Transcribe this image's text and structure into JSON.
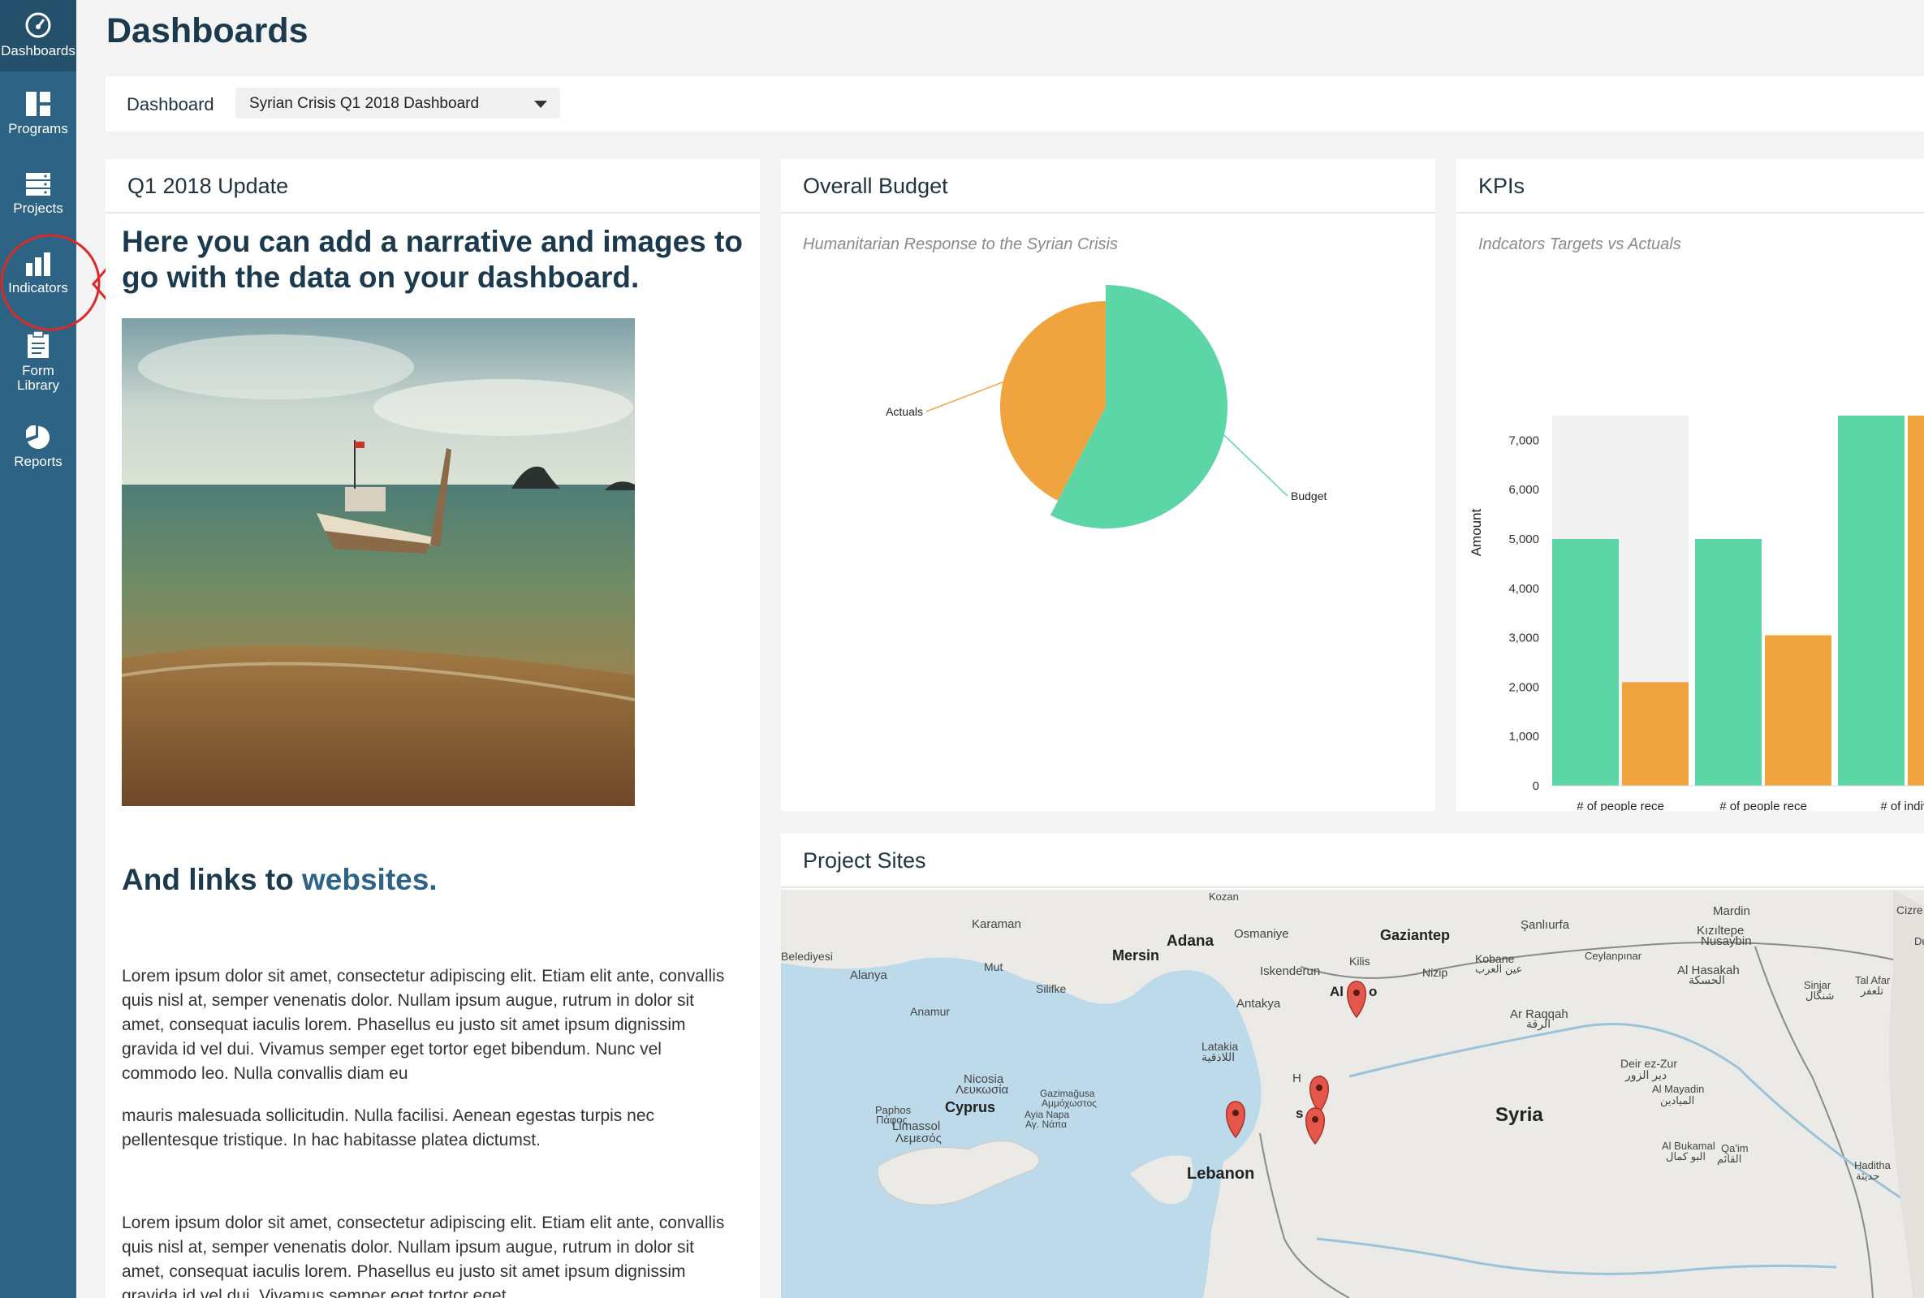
{
  "sidebar": {
    "items": [
      {
        "label": "Dashboards",
        "icon": "speedometer-icon"
      },
      {
        "label": "Programs",
        "icon": "grid-icon"
      },
      {
        "label": "Projects",
        "icon": "server-icon"
      },
      {
        "label": "Indicators",
        "icon": "bar-chart-icon"
      },
      {
        "label_line1": "Form",
        "label_line2": "Library",
        "icon": "clipboard-icon"
      },
      {
        "label": "Reports",
        "icon": "pie-chart-icon"
      }
    ]
  },
  "header": {
    "title": "Dashboards"
  },
  "filter": {
    "label": "Dashboard",
    "selected": "Syrian Crisis Q1 2018 Dashboard"
  },
  "update_card": {
    "title": "Q1 2018 Update",
    "narrative": "Here you can add a narrative and images to go with the data on your dashboard.",
    "links_prefix": "And links to ",
    "links_link": "websites.",
    "paragraph1": "Lorem ipsum dolor sit amet, consectetur adipiscing elit. Etiam elit ante, convallis quis nisl at, semper venenatis dolor. Nullam ipsum augue, rutrum in dolor sit amet, consequat iaculis lorem. Phasellus eu justo sit amet ipsum dignissim gravida id vel dui. Vivamus semper eget tortor eget bibendum. Nunc vel commodo leo. Nulla convallis diam eu",
    "paragraph2": "mauris malesuada sollicitudin. Nulla facilisi. Aenean egestas turpis nec pellentesque tristique. In hac habitasse platea dictumst.",
    "paragraph3": "Lorem ipsum dolor sit amet, consectetur adipiscing elit. Etiam elit ante, convallis quis nisl at, semper venenatis dolor. Nullam ipsum augue, rutrum in dolor sit amet, consequat iaculis lorem. Phasellus eu justo sit amet ipsum dignissim gravida id vel dui. Vivamus semper eget tortor eget"
  },
  "budget_card": {
    "title": "Overall Budget",
    "subtitle": "Humanitarian Response to the Syrian Crisis"
  },
  "kpi_card": {
    "title": "KPIs",
    "subtitle": "Indcators Targets vs Actuals",
    "ylabel": "Amount"
  },
  "map_card": {
    "title": "Project Sites",
    "labels": [
      {
        "text": "Karaman"
      },
      {
        "text": "Adana"
      },
      {
        "text": "Osmaniye"
      },
      {
        "text": "Gaziantep"
      },
      {
        "text": "Şanlıurfa"
      },
      {
        "text": "Mardin"
      },
      {
        "text": "Cizre"
      },
      {
        "text": "Mersin"
      },
      {
        "text": "Belediyesi"
      },
      {
        "text": "Alanya"
      },
      {
        "text": "Mut"
      },
      {
        "text": "Silifke"
      },
      {
        "text": "Kilis"
      },
      {
        "text": "Nizip"
      },
      {
        "text": "Iskenderun"
      },
      {
        "text": "Kobane"
      },
      {
        "text": "عين العرب"
      },
      {
        "text": "Ceylanpınar"
      },
      {
        "text": "Kızıltepe"
      },
      {
        "text": "Nusaybin"
      },
      {
        "text": "Al Hasakah"
      },
      {
        "text": "الحسكة"
      },
      {
        "text": "Antakya"
      },
      {
        "text": "Anamur"
      },
      {
        "text": "Al"
      },
      {
        "text": "o"
      },
      {
        "text": "Ar Raqqah"
      },
      {
        "text": "الرقة"
      },
      {
        "text": "Sinjar"
      },
      {
        "text": "شنگال"
      },
      {
        "text": "Tal Afar"
      },
      {
        "text": "تلعفر"
      },
      {
        "text": "Latakia"
      },
      {
        "text": "اللاذقية"
      },
      {
        "text": "Nicosia"
      },
      {
        "text": "Λευκωσία"
      },
      {
        "text": "Cyprus"
      },
      {
        "text": "Gazimağusa"
      },
      {
        "text": "Αμμόχωστος"
      },
      {
        "text": "Paphos"
      },
      {
        "text": "Πάφος"
      },
      {
        "text": "Limassol"
      },
      {
        "text": "Λεμεσός"
      },
      {
        "text": "Ayia Napa"
      },
      {
        "text": "Αγ. Νάπα"
      },
      {
        "text": "H"
      },
      {
        "text": "a"
      },
      {
        "text": "s"
      },
      {
        "text": "Syria"
      },
      {
        "text": "Deir ez-Zur"
      },
      {
        "text": "دير الزور"
      },
      {
        "text": "Al Mayadin"
      },
      {
        "text": "الميادين"
      },
      {
        "text": "Al Bukamal"
      },
      {
        "text": "البو كمال"
      },
      {
        "text": "Qa'im"
      },
      {
        "text": "القائم"
      },
      {
        "text": "Haditha"
      },
      {
        "text": "حديثة"
      },
      {
        "text": "Lebanon"
      },
      {
        "text": "Du"
      },
      {
        "text": "Kozan"
      }
    ]
  },
  "chart_data": [
    {
      "type": "pie",
      "title": "Overall Budget",
      "subtitle": "Humanitarian Response to the Syrian Crisis",
      "slices": [
        {
          "label": "Budget",
          "value": 57.5,
          "color": "#5cd5a7"
        },
        {
          "label": "Actuals",
          "value": 42.5,
          "color": "#f0a43f"
        }
      ]
    },
    {
      "type": "bar",
      "title": "KPIs",
      "subtitle": "Indcators Targets vs Actuals",
      "ylabel": "Amount",
      "ylim": [
        0,
        7500
      ],
      "yticks": [
        "0",
        "1,000",
        "2,000",
        "3,000",
        "4,000",
        "5,000",
        "6,000",
        "7,000"
      ],
      "categories": [
        "# of people rece",
        "# of people rece",
        "# of indivi"
      ],
      "series": [
        {
          "values": [
            5000,
            5000,
            7500
          ],
          "color": "#5cd5a7"
        },
        {
          "values": [
            2100,
            3050,
            7500
          ],
          "color": "#f0a43f"
        }
      ]
    }
  ]
}
